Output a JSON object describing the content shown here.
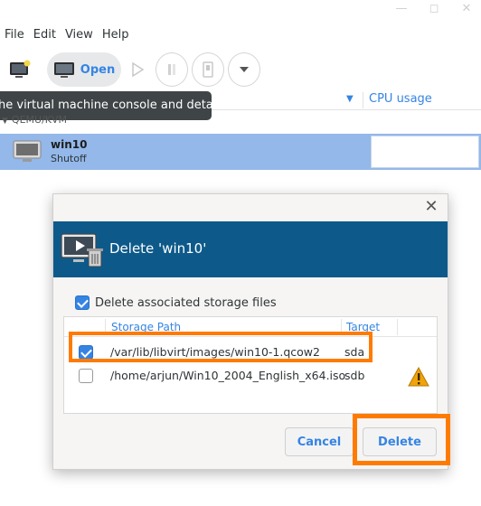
{
  "window": {
    "controls": [
      "minimize-icon",
      "maximize-icon",
      "close-icon"
    ]
  },
  "menubar": {
    "items": [
      "File",
      "Edit",
      "View",
      "Help"
    ]
  },
  "toolbar": {
    "open_label": "Open",
    "tooltip": "he virtual machine console and details"
  },
  "list": {
    "col_cpu": "CPU usage",
    "group": "QEMU/KVM",
    "vm": {
      "name": "win10",
      "state": "Shutoff"
    }
  },
  "dialog": {
    "title": "Delete 'win10'",
    "assoc_label": "Delete associated storage files",
    "assoc_checked": true,
    "table": {
      "headers": {
        "path": "Storage Path",
        "target": "Target"
      },
      "rows": [
        {
          "checked": true,
          "path": "/var/lib/libvirt/images/win10-1.qcow2",
          "target": "sda",
          "warning": false
        },
        {
          "checked": false,
          "path": "/home/arjun/Win10_2004_English_x64.iso",
          "target": "sdb",
          "warning": true
        }
      ]
    },
    "cancel_label": "Cancel",
    "delete_label": "Delete"
  },
  "colors": {
    "accent": "#3584e4",
    "banner": "#0d5a8a",
    "selection": "#93b8e9",
    "highlight": "#ff7b00",
    "warning": "#f0a30a"
  }
}
